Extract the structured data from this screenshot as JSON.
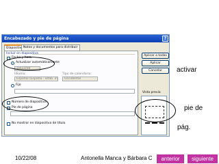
{
  "dialog": {
    "title": "Encabezado y pie de página",
    "help_glyph": "?",
    "tabs": [
      {
        "label": "Diapositiva"
      },
      {
        "label": "Notas y documentos para distribuir"
      }
    ],
    "section_label": "Incluir en diapositiva",
    "date_time_label": "Fecha y hora",
    "auto_update_label": "Actualizar automáticamente",
    "auto_date_value": "10/22/08",
    "language_label": "Idioma:",
    "language_value": "Español (España - alfab. internacional)",
    "calendar_label": "Tipo de calendario:",
    "calendar_value": "Occidental",
    "fixed_label": "Fijo",
    "slide_number_label": "Número de diapositiva",
    "footer_label": "Pie de página",
    "title_slide_label": "No mostrar en diapositiva de título",
    "buttons": {
      "apply_all": "Aplicar a todas",
      "apply": "Aplicar",
      "cancel": "Cancelar"
    },
    "preview_label": "Vista previa"
  },
  "annotations": {
    "activar": "activar",
    "pie_de": "pie de",
    "pag": "pág."
  },
  "footer": {
    "date": "10/22/08",
    "author": "Antonella Manca y Bárbara Callegari"
  },
  "nav": {
    "prev": "anterior",
    "next": "siguiente",
    "color": "#c033a0"
  }
}
